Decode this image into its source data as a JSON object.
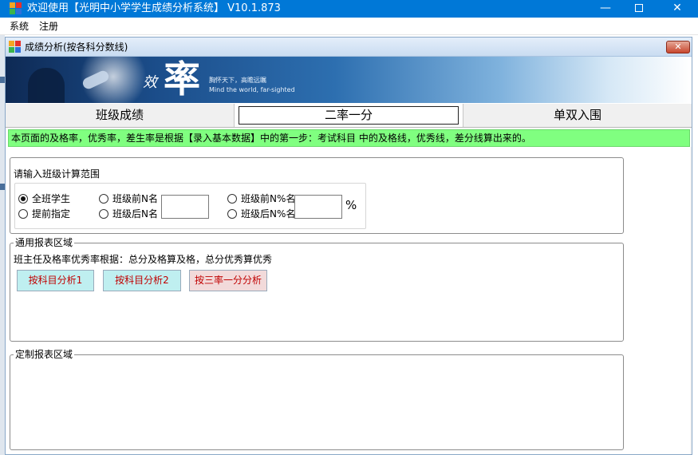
{
  "window": {
    "title": "欢迎使用【光明中小学学生成绩分析系统】 V10.1.873",
    "min_glyph": "—",
    "close_glyph": "✕"
  },
  "menu": {
    "items": [
      "系统",
      "注册"
    ]
  },
  "inner_window": {
    "title": "成绩分析(按各科分数线)",
    "close_glyph": "✕"
  },
  "banner": {
    "small_char": "效",
    "big_char": "率",
    "slogan": "胸怀天下，高瞻远瞩",
    "slogan_en": "Mind the world, far-sighted"
  },
  "tabs": [
    {
      "label": "班级成绩",
      "active": false
    },
    {
      "label": "二率一分",
      "active": true
    },
    {
      "label": "单双入围",
      "active": false
    }
  ],
  "notice": "本页面的及格率，优秀率，差生率是根据【录入基本数据】中的第一步：考试科目 中的及格线，优秀线，差分线算出来的。",
  "range_panel": {
    "title": "请输入班级计算范围",
    "options": {
      "all": "全班学生",
      "preset": "提前指定",
      "top_n": "班级前N名",
      "bottom_n": "班级后N名",
      "top_pct": "班级前N%名",
      "bottom_pct": "班级后N%名"
    },
    "selected": "all",
    "n_value": "",
    "pct_value": "",
    "pct_unit": "%"
  },
  "common_panel": {
    "legend": "通用报表区域",
    "basis": "班主任及格率优秀率根据：总分及格算及格，总分优秀算优秀",
    "buttons": [
      "按科目分析1",
      "按科目分析2",
      "按三率一分分析"
    ]
  },
  "custom_panel": {
    "legend": "定制报表区域"
  },
  "colors": {
    "title_bar": "#0078d7",
    "notice_bg": "#80ff80",
    "button_cyan": "#bfeff0",
    "button_pink": "#f2dada",
    "button_text": "#c00000"
  }
}
